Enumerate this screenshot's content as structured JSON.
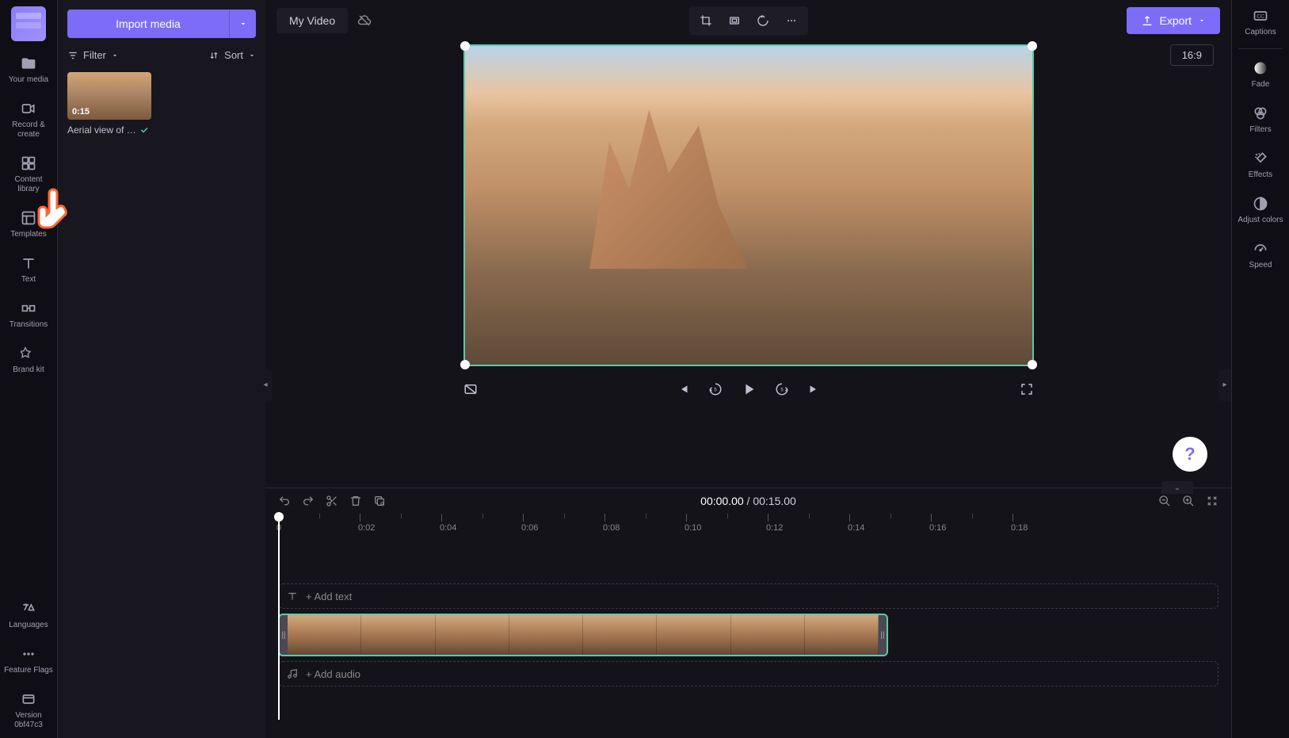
{
  "left_sidebar": {
    "items": [
      {
        "label": "Your media"
      },
      {
        "label": "Record & create"
      },
      {
        "label": "Content library"
      },
      {
        "label": "Templates"
      },
      {
        "label": "Text"
      },
      {
        "label": "Transitions"
      },
      {
        "label": "Brand kit"
      }
    ],
    "bottom_items": [
      {
        "label": "Languages"
      },
      {
        "label": "Feature Flags"
      },
      {
        "label": "Version 0bf47c3"
      }
    ]
  },
  "media_panel": {
    "import_label": "Import media",
    "filter_label": "Filter",
    "sort_label": "Sort",
    "clip": {
      "duration": "0:15",
      "name": "Aerial view of …"
    }
  },
  "top_bar": {
    "project_name": "My Video",
    "export_label": "Export",
    "aspect_ratio": "16:9"
  },
  "playback": {
    "current_time": "00:00.00",
    "separator": " / ",
    "total_time": "00:15.00"
  },
  "timeline": {
    "ticks": [
      "0",
      "0:02",
      "0:04",
      "0:06",
      "0:08",
      "0:10",
      "0:12",
      "0:14",
      "0:16",
      "0:18"
    ],
    "add_text": "+ Add text",
    "add_audio": "+ Add audio"
  },
  "right_sidebar": {
    "items": [
      {
        "label": "Captions"
      },
      {
        "label": "Fade"
      },
      {
        "label": "Filters"
      },
      {
        "label": "Effects"
      },
      {
        "label": "Adjust colors"
      },
      {
        "label": "Speed"
      }
    ]
  }
}
